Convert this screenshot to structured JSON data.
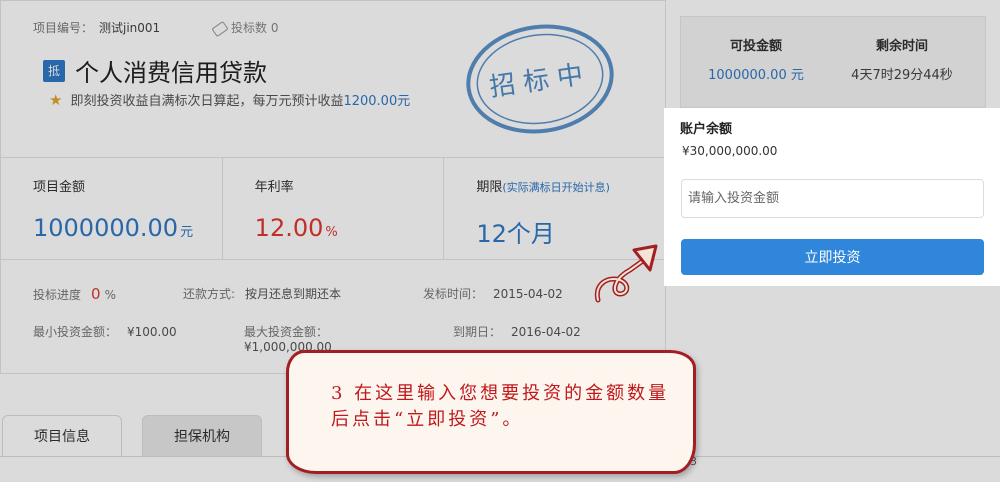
{
  "project": {
    "number_label": "项目编号：",
    "number_value": "测试jin001",
    "bid_count": "投标数 0",
    "type_badge": "抵",
    "title": "个人消费信用贷款",
    "subtitle_prefix": "即刻投资收益自满标次日算起，每万元预计收益",
    "subtitle_amount": "1200.00元",
    "stamp_text": "招标中"
  },
  "metrics": [
    {
      "label": "项目金额",
      "hint": "",
      "value": "1000000.00",
      "unit": "元"
    },
    {
      "label": "年利率",
      "hint": "",
      "value": "12.00",
      "unit": "%"
    },
    {
      "label": "期限",
      "hint": "(实际满标日开始计息)",
      "value": "12个月",
      "unit": ""
    }
  ],
  "details": {
    "progress_label": "投标进度",
    "progress_value": "0",
    "progress_unit": "%",
    "repay_label": "还款方式:",
    "repay_value": "按月还息到期还本",
    "publish_label": "发标时间：",
    "publish_value": "2015-04-02",
    "min_label": "最小投资金额：",
    "min_value": "¥100.00",
    "max_label": "最大投资金额：",
    "max_value": "¥1,000,000.00",
    "due_label": "到期日：",
    "due_value": "2016-04-02"
  },
  "tabs": [
    {
      "label": "项目信息"
    },
    {
      "label": "担保机构"
    }
  ],
  "page_fragment": "3",
  "sidebar": {
    "investable_label": "可投金额",
    "investable_value": "1000000.00 元",
    "remaining_label": "剩余时间",
    "remaining_value": "4天7时29分44秒"
  },
  "account": {
    "title": "账户余额",
    "balance": "¥30,000,000.00",
    "input_placeholder": "请输入投资金额",
    "input_value": "",
    "invest_button": "立即投资"
  },
  "annotation": {
    "text": "3 在这里输入您想要投资的金额数量后点击“立即投资”。",
    "color": "#c0181c"
  },
  "colors": {
    "accent": "#2f78c5",
    "button": "#2f86da",
    "rate": "#e0382f"
  }
}
